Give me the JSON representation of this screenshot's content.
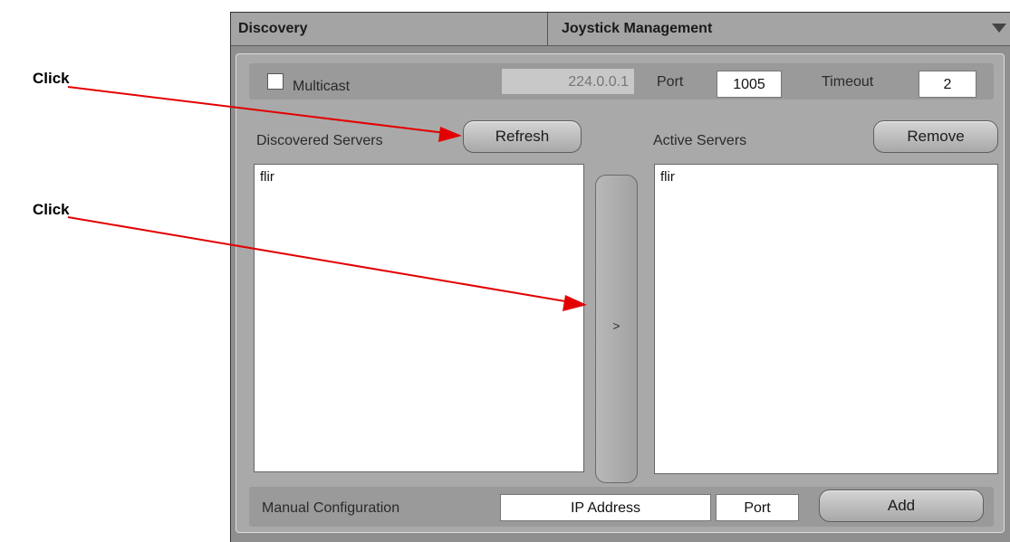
{
  "callouts": {
    "first": "Click",
    "second": "Click"
  },
  "tabs": {
    "discovery": "Discovery",
    "joystick": "Joystick Management"
  },
  "multicast": {
    "label": "Multicast",
    "checked": false,
    "address": "224.0.0.1"
  },
  "port": {
    "label": "Port",
    "value": "1005"
  },
  "timeout": {
    "label": "Timeout",
    "value": "2"
  },
  "discovered": {
    "label": "Discovered Servers",
    "refresh_label": "Refresh",
    "items": [
      "flir"
    ]
  },
  "active": {
    "label": "Active Servers",
    "remove_label": "Remove",
    "items": [
      "flir"
    ]
  },
  "move_button_label": ">",
  "manual": {
    "label": "Manual Configuration",
    "ip_value": "IP Address",
    "port_value": "Port",
    "add_label": "Add"
  },
  "colors": {
    "arrow": "#e30000",
    "panel": "#a9a9a9",
    "frame": "#8f8f8f"
  },
  "icons": {
    "tab_dropdown": "chevron-down-icon"
  }
}
